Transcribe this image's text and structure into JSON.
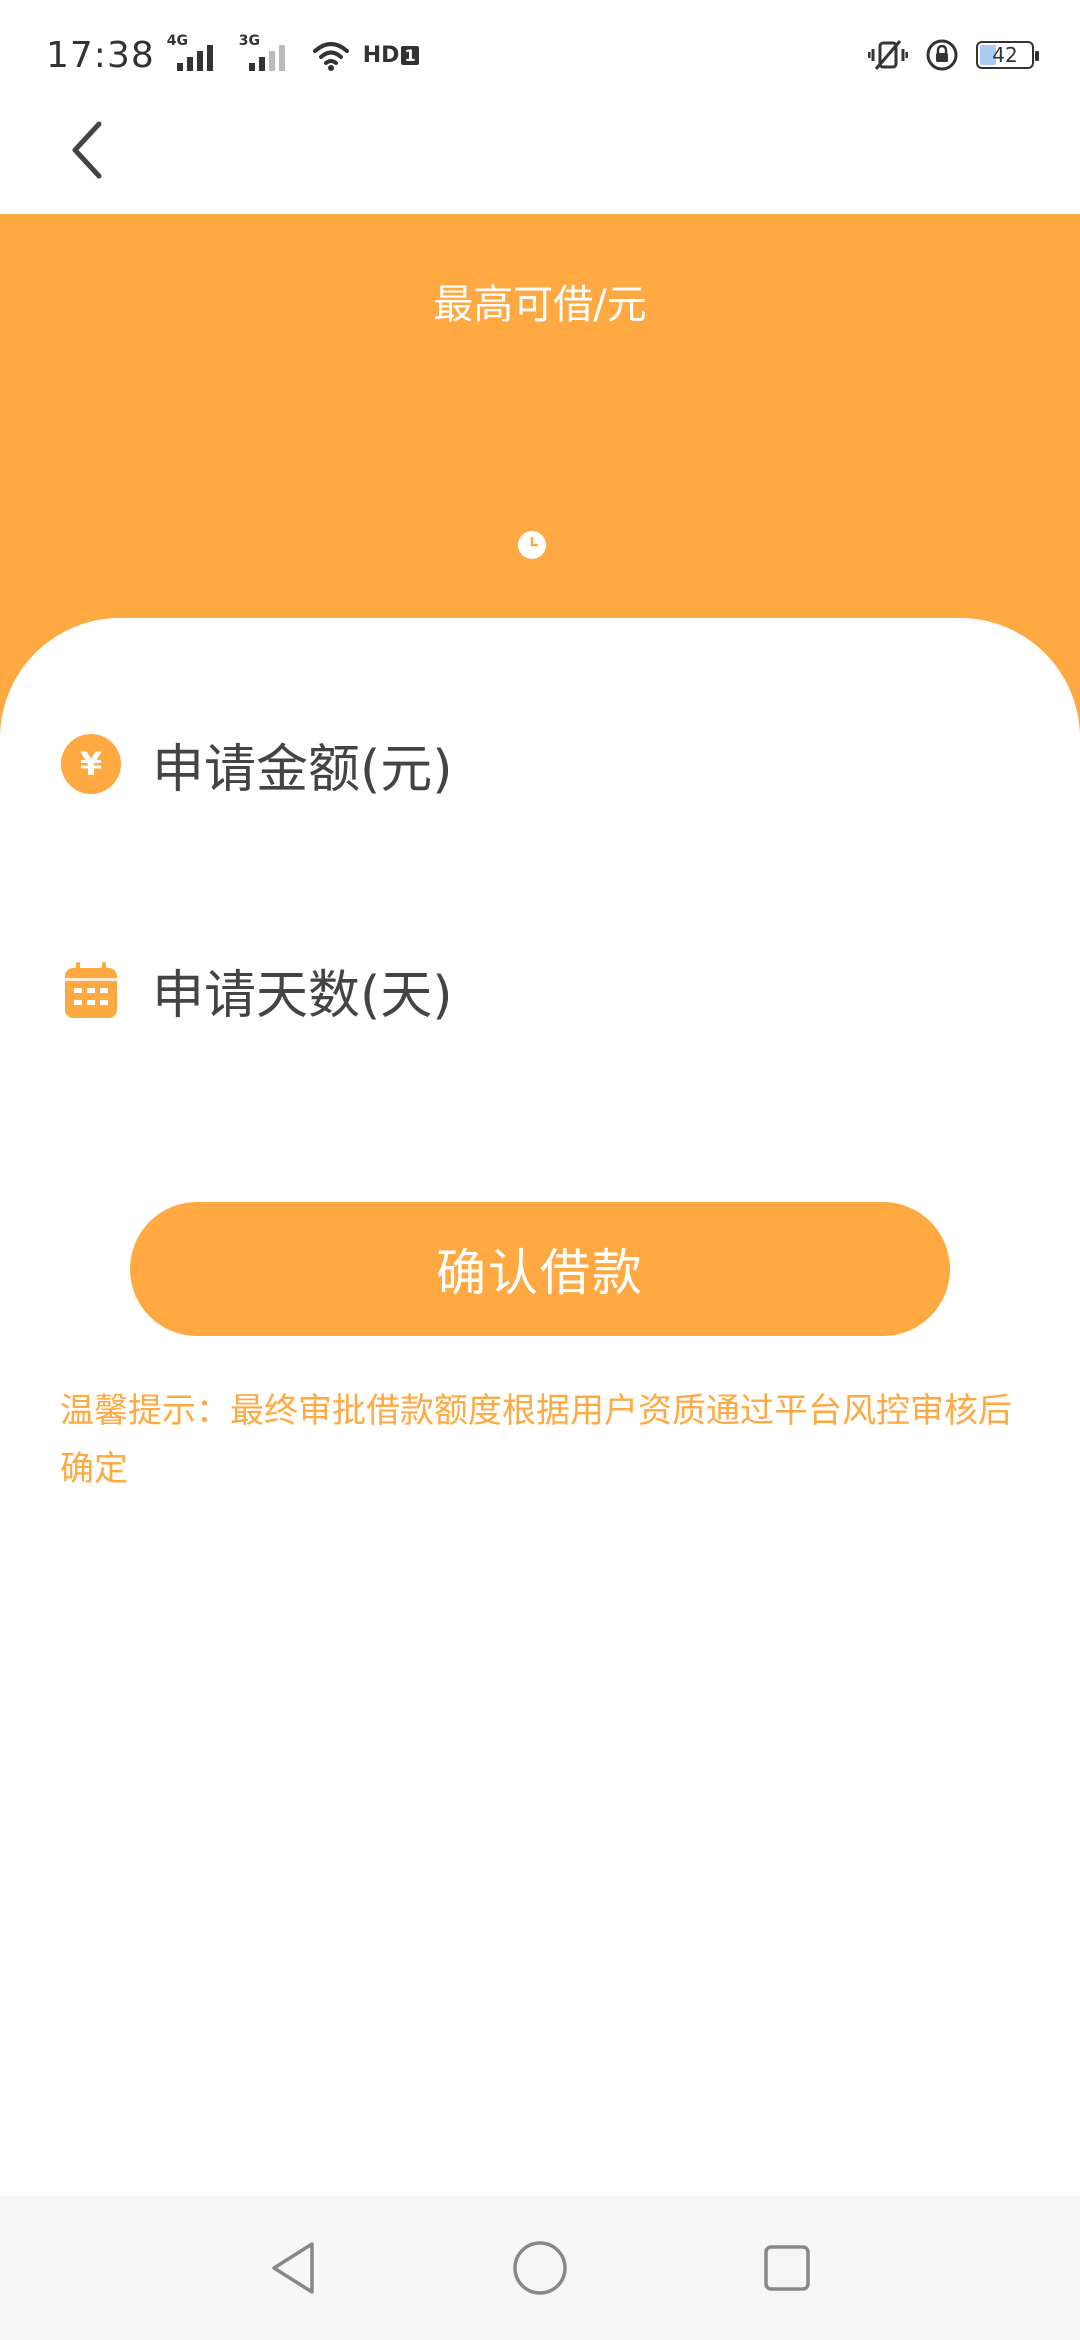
{
  "status_bar": {
    "time": "17:38",
    "network_1": "4G",
    "network_2": "3G",
    "hd_label": "HD",
    "hd_sim": "1",
    "battery": "42"
  },
  "hero": {
    "title": "最高可借/元"
  },
  "form": {
    "amount_label": "申请金额(元)",
    "amount_icon_glyph": "¥",
    "days_label": "申请天数(天)"
  },
  "confirm_button": {
    "label": "确认借款"
  },
  "tip": {
    "text": "温馨提示：最终审批借款额度根据用户资质通过平台风控审核后确定"
  },
  "colors": {
    "accent": "#ffa942",
    "text": "#444444",
    "nav_bg": "#f6f6f6"
  }
}
